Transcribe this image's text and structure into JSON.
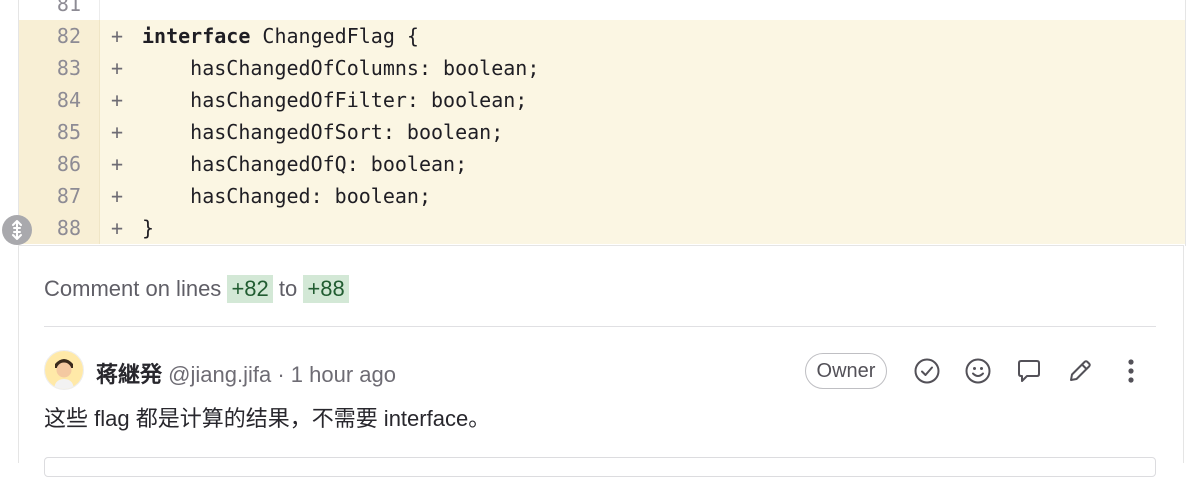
{
  "diff": {
    "lines": [
      {
        "num": "81",
        "marker": "",
        "code": ""
      },
      {
        "num": "82",
        "marker": "+",
        "keyword": "interface",
        "code": " ChangedFlag {"
      },
      {
        "num": "83",
        "marker": "+",
        "code": "    hasChangedOfColumns: boolean;"
      },
      {
        "num": "84",
        "marker": "+",
        "code": "    hasChangedOfFilter: boolean;"
      },
      {
        "num": "85",
        "marker": "+",
        "code": "    hasChangedOfSort: boolean;"
      },
      {
        "num": "86",
        "marker": "+",
        "code": "    hasChangedOfQ: boolean;"
      },
      {
        "num": "87",
        "marker": "+",
        "code": "    hasChanged: boolean;"
      },
      {
        "num": "88",
        "marker": "+",
        "code": "}"
      }
    ],
    "added_color": "#fbf6e3"
  },
  "comment_on": {
    "prefix": "Comment on lines",
    "start": "+82",
    "connector": "to",
    "end": "+88"
  },
  "note": {
    "author": "蒋継発",
    "username": "@jiang.jifa",
    "separator": "·",
    "time": "1 hour ago",
    "role_badge": "Owner",
    "body": "这些 flag 都是计算的结果，不需要 interface。",
    "actions": [
      "resolve-icon",
      "emoji-icon",
      "reply-icon",
      "edit-icon",
      "more-icon"
    ]
  }
}
